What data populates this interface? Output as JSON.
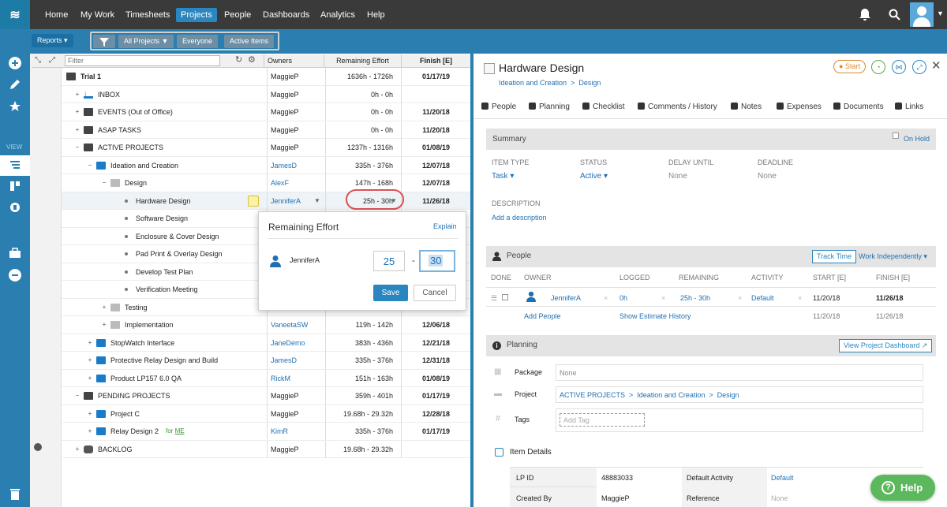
{
  "nav": {
    "items": [
      "Home",
      "My Work",
      "Timesheets",
      "Projects",
      "People",
      "Dashboards",
      "Analytics",
      "Help"
    ],
    "active": "Projects"
  },
  "toolbar": {
    "reports": "Reports ▾",
    "all_projects": "All Projects ▼",
    "everyone": "Everyone",
    "active_items": "Active Items"
  },
  "rail": {
    "view_label": "VIEW"
  },
  "tree": {
    "filter_placeholder": "Filter",
    "headers": {
      "owners": "Owners",
      "effort": "Remaining Effort",
      "finish": "Finish [E]"
    },
    "rows": [
      {
        "name": "Trial 1",
        "owner": "MaggieP",
        "effort": "1636h - 1726h",
        "finish": "01/17/19"
      },
      {
        "name": "INBOX",
        "owner": "MaggieP",
        "effort": "0h - 0h",
        "finish": ""
      },
      {
        "name": "EVENTS (Out of Office)",
        "owner": "MaggieP",
        "effort": "0h - 0h",
        "finish": "11/20/18"
      },
      {
        "name": "ASAP TASKS",
        "owner": "MaggieP",
        "effort": "0h - 0h",
        "finish": "11/20/18"
      },
      {
        "name": "ACTIVE PROJECTS",
        "owner": "MaggieP",
        "effort": "1237h - 1316h",
        "finish": "01/08/19"
      },
      {
        "name": "Ideation and Creation",
        "owner": "JamesD",
        "effort": "335h - 376h",
        "finish": "12/07/18"
      },
      {
        "name": "Design",
        "owner": "AlexF",
        "effort": "147h - 168h",
        "finish": "12/07/18"
      },
      {
        "name": "Hardware Design",
        "owner": "JenniferA",
        "effort": "25h - 30h",
        "finish": "11/26/18"
      },
      {
        "name": "Software Design",
        "owner": "",
        "effort": "",
        "finish": ""
      },
      {
        "name": "Enclosure & Cover Design",
        "owner": "",
        "effort": "",
        "finish": ""
      },
      {
        "name": "Pad Print & Overlay Design",
        "owner": "",
        "effort": "",
        "finish": ""
      },
      {
        "name": "Develop Test Plan",
        "owner": "",
        "effort": "",
        "finish": ""
      },
      {
        "name": "Verification Meeting",
        "owner": "",
        "effort": "",
        "finish": ""
      },
      {
        "name": "Testing",
        "owner": "",
        "effort": "",
        "finish": ""
      },
      {
        "name": "Implementation",
        "owner": "VaneetaSW",
        "effort": "119h - 142h",
        "finish": "12/06/18"
      },
      {
        "name": "StopWatch Interface",
        "owner": "JaneDemo",
        "effort": "383h - 436h",
        "finish": "12/21/18"
      },
      {
        "name": "Protective Relay Design and Build",
        "owner": "JamesD",
        "effort": "335h - 376h",
        "finish": "12/31/18"
      },
      {
        "name": "Product LP157 6.0 QA",
        "owner": "RickM",
        "effort": "151h - 163h",
        "finish": "01/08/19"
      },
      {
        "name": "PENDING PROJECTS",
        "owner": "MaggieP",
        "effort": "359h - 401h",
        "finish": "01/17/19"
      },
      {
        "name": "Project C",
        "owner": "MaggieP",
        "effort": "19.68h - 29.32h",
        "finish": "12/28/18"
      },
      {
        "name": "Relay Design 2",
        "owner": "KimR",
        "effort": "335h - 376h",
        "finish": "01/17/19"
      },
      {
        "name": "BACKLOG",
        "owner": "MaggieP",
        "effort": "19.68h - 29.32h",
        "finish": ""
      }
    ],
    "for_me": "for ME"
  },
  "popover": {
    "title": "Remaining Effort",
    "explain": "Explain",
    "person": "JenniferA",
    "low": "25",
    "high": "30",
    "save": "Save",
    "cancel": "Cancel"
  },
  "detail": {
    "title": "Hardware Design",
    "breadcrumb": "Ideation and Creation  >  Design",
    "start": "Start",
    "tabs": [
      "People",
      "Planning",
      "Checklist",
      "Comments / History",
      "Notes",
      "Expenses",
      "Documents",
      "Links"
    ],
    "summary": {
      "heading": "Summary",
      "on_hold": "On Hold",
      "item_type_label": "ITEM TYPE",
      "item_type": "Task ▾",
      "status_label": "STATUS",
      "status": "Active ▾",
      "delay_label": "DELAY UNTIL",
      "delay": "None",
      "deadline_label": "DEADLINE",
      "deadline": "None",
      "description_label": "DESCRIPTION",
      "add_description": "Add a description"
    },
    "people": {
      "heading": "People",
      "track_time": "Track Time",
      "work_mode": "Work Independently ▾",
      "cols": [
        "DONE",
        "OWNER",
        "LOGGED",
        "REMAINING",
        "ACTIVITY",
        "START [E]",
        "FINISH [E]"
      ],
      "row": {
        "owner": "JenniferA",
        "logged": "0h",
        "remaining": "25h - 30h",
        "activity": "Default",
        "start": "11/20/18",
        "finish": "11/26/18"
      },
      "add_people": "Add People",
      "history": "Show Estimate History",
      "start2": "11/20/18",
      "finish2": "11/26/18"
    },
    "planning": {
      "heading": "Planning",
      "dashboard": "View Project Dashboard ↗",
      "package_label": "Package",
      "package": "None",
      "project_label": "Project",
      "project": "ACTIVE PROJECTS  >  Ideation and Creation  >  Design",
      "tags_label": "Tags",
      "add_tag": "Add Tag"
    },
    "item_details": {
      "heading": "Item Details",
      "lpid_label": "LP ID",
      "lpid": "48883033",
      "created_label": "Created By",
      "created": "MaggieP",
      "activity_label": "Default Activity",
      "activity": "Default",
      "reference_label": "Reference",
      "reference": "None"
    }
  },
  "help": "Help"
}
